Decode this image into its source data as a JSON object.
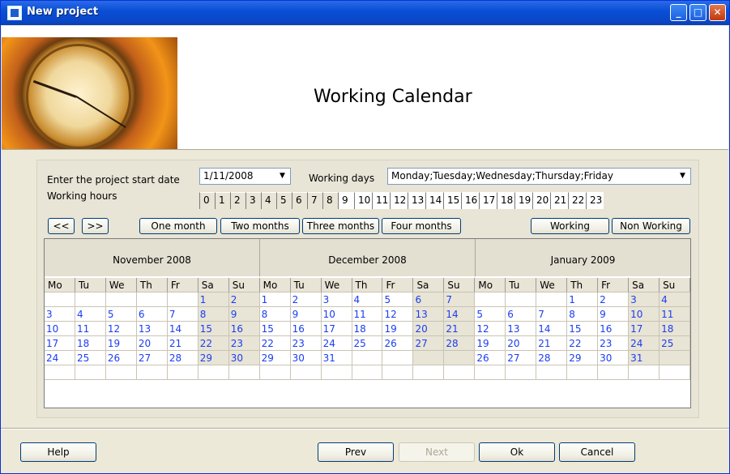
{
  "window": {
    "title": "New project",
    "controls": [
      "minimize",
      "maximize",
      "close"
    ]
  },
  "header": {
    "title": "Working Calendar"
  },
  "form": {
    "start_date_label": "Enter the project start date",
    "start_date_value": "1/11/2008",
    "working_days_label": "Working days",
    "working_days_value": "Monday;Tuesday;Wednesday;Thursday;Friday",
    "working_hours_label": "Working hours",
    "hours": [
      "0",
      "1",
      "2",
      "3",
      "4",
      "5",
      "6",
      "7",
      "8",
      "9",
      "10",
      "11",
      "12",
      "13",
      "14",
      "15",
      "16",
      "17",
      "18",
      "19",
      "20",
      "21",
      "22",
      "23"
    ],
    "working_hours_selected_from": 9,
    "working_hours_selected_to": 23
  },
  "toolbar": {
    "prev_label": "<<",
    "next_label": ">>",
    "one_month": "One month",
    "two_months": "Two months",
    "three_months": "Three months",
    "four_months": "Four months",
    "working": "Working",
    "non_working": "Non Working"
  },
  "calendar": {
    "weekdays": [
      "Mo",
      "Tu",
      "We",
      "Th",
      "Fr",
      "Sa",
      "Su"
    ],
    "months": [
      {
        "name": "November 2008",
        "weeks": [
          [
            "",
            "",
            "",
            "",
            "",
            "1",
            "2"
          ],
          [
            "3",
            "4",
            "5",
            "6",
            "7",
            "8",
            "9"
          ],
          [
            "10",
            "11",
            "12",
            "13",
            "14",
            "15",
            "16"
          ],
          [
            "17",
            "18",
            "19",
            "20",
            "21",
            "22",
            "23"
          ],
          [
            "24",
            "25",
            "26",
            "27",
            "28",
            "29",
            "30"
          ],
          [
            "",
            "",
            "",
            "",
            "",
            "",
            ""
          ]
        ]
      },
      {
        "name": "December 2008",
        "weeks": [
          [
            "1",
            "2",
            "3",
            "4",
            "5",
            "6",
            "7"
          ],
          [
            "8",
            "9",
            "10",
            "11",
            "12",
            "13",
            "14"
          ],
          [
            "15",
            "16",
            "17",
            "18",
            "19",
            "20",
            "21"
          ],
          [
            "22",
            "23",
            "24",
            "25",
            "26",
            "27",
            "28"
          ],
          [
            "29",
            "30",
            "31",
            "",
            "",
            "",
            ""
          ],
          [
            "",
            "",
            "",
            "",
            "",
            "",
            ""
          ]
        ]
      },
      {
        "name": "January 2009",
        "weeks": [
          [
            "",
            "",
            "",
            "1",
            "2",
            "3",
            "4"
          ],
          [
            "5",
            "6",
            "7",
            "8",
            "9",
            "10",
            "11"
          ],
          [
            "12",
            "13",
            "14",
            "15",
            "16",
            "17",
            "18"
          ],
          [
            "19",
            "20",
            "21",
            "22",
            "23",
            "24",
            "25"
          ],
          [
            "26",
            "27",
            "28",
            "29",
            "30",
            "31",
            ""
          ],
          [
            "",
            "",
            "",
            "",
            "",
            "",
            ""
          ]
        ]
      }
    ]
  },
  "footer": {
    "help": "Help",
    "prev": "Prev",
    "next": "Next",
    "ok": "Ok",
    "cancel": "Cancel"
  },
  "colors": {
    "titlebar": "#0a4fd6",
    "day_text": "#1b3df2",
    "weekend_bg": "#e8e4d6",
    "dialog_bg": "#ece9d8"
  }
}
